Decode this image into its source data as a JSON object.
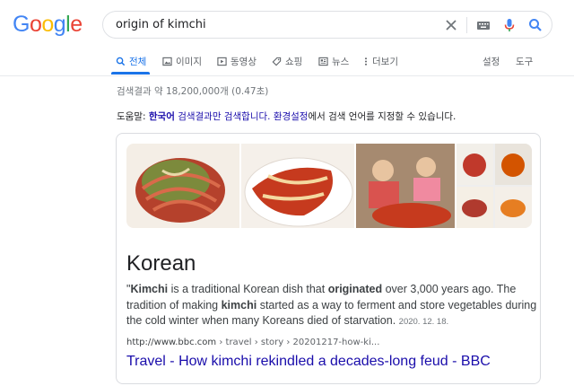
{
  "logo": {
    "letters": [
      "G",
      "o",
      "o",
      "g",
      "l",
      "e"
    ],
    "colors": [
      "#4285F4",
      "#EA4335",
      "#FBBC05",
      "#4285F4",
      "#34A853",
      "#EA4335"
    ]
  },
  "search": {
    "query": "origin of kimchi",
    "clear_icon": "close-icon",
    "keyboard_icon": "keyboard-icon",
    "voice_icon": "microphone-icon",
    "search_icon": "search-icon"
  },
  "tabs": [
    {
      "label": "전체",
      "icon": "search-icon",
      "active": true
    },
    {
      "label": "이미지",
      "icon": "image-icon"
    },
    {
      "label": "동영상",
      "icon": "video-icon"
    },
    {
      "label": "쇼핑",
      "icon": "tag-icon"
    },
    {
      "label": "뉴스",
      "icon": "news-icon"
    },
    {
      "label": "더보기",
      "icon": "more-icon"
    }
  ],
  "tools": {
    "settings": "설정",
    "tools": "도구"
  },
  "stats": "검색결과 약 18,200,000개 (0.47초)",
  "help": {
    "prefix": "도움말:",
    "lang": "한국어",
    "link": "검색결과만 검색합니다.",
    "settings_link": "환경설정",
    "suffix": "에서 검색 언어를 지정할 수 있습니다."
  },
  "featured": {
    "answer": "Korean",
    "snippet": {
      "q": "\"",
      "t1": "Kimchi",
      "t2": " is a traditional Korean dish that ",
      "t3": "originated",
      "t4": " over 3,000 years ago. The tradition of making ",
      "t5": "kimchi",
      "t6": " started as a way to ferment and store vegetables during the cold winter when many Koreans died of starvation.",
      "date": "2020. 12. 18."
    },
    "cite_domain": "http://www.bbc.com",
    "cite_path": " › travel › story › 20201217-how-ki...",
    "title": "Travel - How kimchi rekindled a decades-long feud - BBC"
  },
  "colors": {
    "link": "#1a0dab",
    "accent": "#1a73e8"
  }
}
